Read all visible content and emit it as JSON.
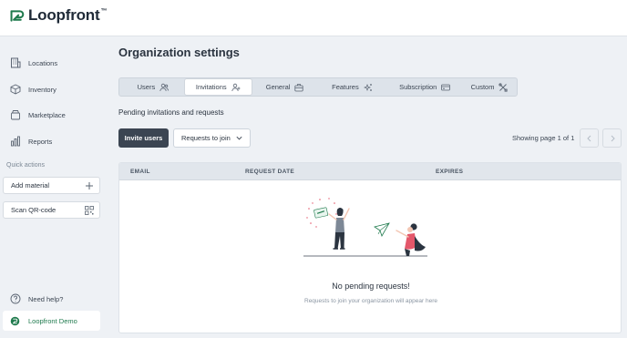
{
  "app": {
    "brand": "Loopfront",
    "trademark": "™",
    "brand_color": "#1f7a4d"
  },
  "sidebar": {
    "items": [
      {
        "label": "Locations",
        "icon": "building-icon"
      },
      {
        "label": "Inventory",
        "icon": "box-icon"
      },
      {
        "label": "Marketplace",
        "icon": "store-icon"
      },
      {
        "label": "Reports",
        "icon": "bar-chart-icon"
      }
    ],
    "quick_actions_label": "Quick actions",
    "quick_actions": [
      {
        "label": "Add material",
        "icon": "plus-icon"
      },
      {
        "label": "Scan QR-code",
        "icon": "qr-code-icon"
      }
    ],
    "help_label": "Need help?",
    "org_label": "Loopfront Demo"
  },
  "main": {
    "title": "Organization settings",
    "tabs": [
      {
        "label": "Users",
        "icon": "users-icon",
        "active": false
      },
      {
        "label": "Invitations",
        "icon": "user-plus-icon",
        "active": true
      },
      {
        "label": "General",
        "icon": "briefcase-icon",
        "active": false
      },
      {
        "label": "Features",
        "icon": "sparkles-icon",
        "active": false
      },
      {
        "label": "Subscription",
        "icon": "credit-card-icon",
        "active": false
      },
      {
        "label": "Custom",
        "icon": "tools-icon",
        "active": false
      }
    ],
    "subtitle": "Pending invitations and requests",
    "invite_button": "Invite users",
    "filter_dropdown": "Requests to join",
    "paging_text": "Showing page 1 of 1",
    "table": {
      "columns": [
        "EMAIL",
        "REQUEST DATE",
        "EXPIRES"
      ]
    },
    "empty_state": {
      "title": "No pending requests!",
      "text": "Requests to join your organization will appear here"
    }
  }
}
